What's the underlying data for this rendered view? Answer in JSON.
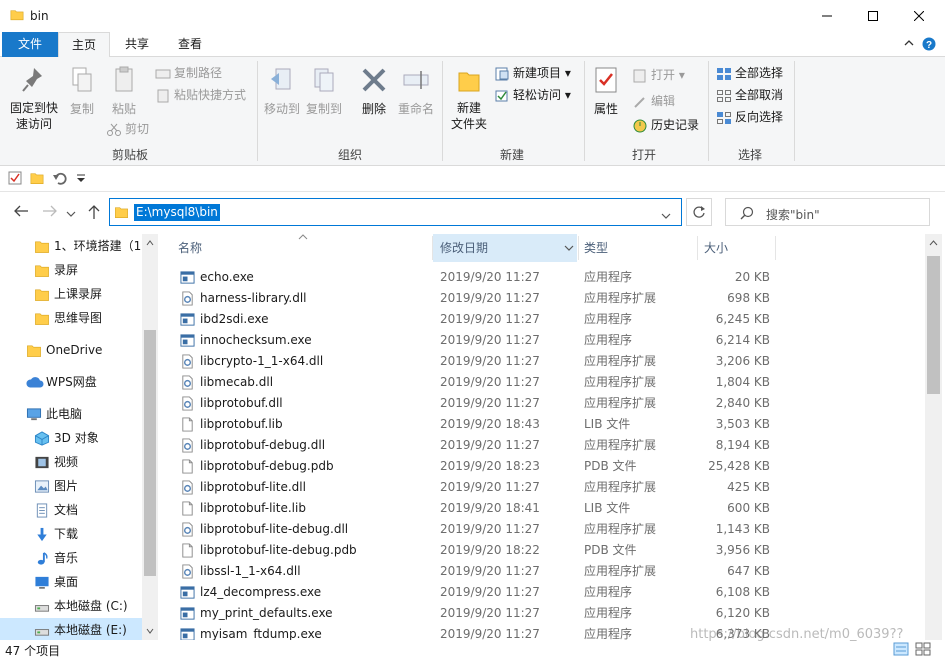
{
  "window": {
    "title": "bin"
  },
  "tabs": {
    "file": "文件",
    "home": "主页",
    "share": "共享",
    "view": "查看"
  },
  "ribbon": {
    "pin": "固定到快\n速访问",
    "copy": "复制",
    "paste": "粘贴",
    "copy_path": "复制路径",
    "paste_shortcut": "粘贴快捷方式",
    "cut": "剪切",
    "clipboard_label": "剪贴板",
    "move_to": "移动到",
    "copy_to": "复制到",
    "delete": "删除",
    "rename": "重命名",
    "organize_label": "组织",
    "new_folder": "新建\n文件夹",
    "new_item": "新建项目",
    "easy_access": "轻松访问",
    "new_label": "新建",
    "properties": "属性",
    "open": "打开",
    "edit": "编辑",
    "history": "历史记录",
    "open_label": "打开",
    "select_all": "全部选择",
    "select_none": "全部取消",
    "invert_selection": "反向选择",
    "select_label": "选择"
  },
  "address": {
    "path": "E:\\mysql8\\bin",
    "search_placeholder": "搜索\"bin\""
  },
  "nav": {
    "items": [
      {
        "label": "1、环境搭建（1",
        "icon": "folder-icon"
      },
      {
        "label": "录屏",
        "icon": "folder-icon"
      },
      {
        "label": "上课录屏",
        "icon": "folder-icon"
      },
      {
        "label": "思维导图",
        "icon": "folder-icon"
      },
      {
        "label": "OneDrive",
        "icon": "onedrive-icon"
      },
      {
        "label": "WPS网盘",
        "icon": "wps-cloud-icon"
      },
      {
        "label": "此电脑",
        "icon": "computer-icon"
      },
      {
        "label": "3D 对象",
        "icon": "3d-objects-icon"
      },
      {
        "label": "视频",
        "icon": "video-icon"
      },
      {
        "label": "图片",
        "icon": "pictures-icon"
      },
      {
        "label": "文档",
        "icon": "documents-icon"
      },
      {
        "label": "下载",
        "icon": "download-icon"
      },
      {
        "label": "音乐",
        "icon": "music-icon"
      },
      {
        "label": "桌面",
        "icon": "desktop-icon"
      },
      {
        "label": "本地磁盘 (C:)",
        "icon": "drive-icon"
      },
      {
        "label": "本地磁盘 (E:)",
        "icon": "drive-icon"
      }
    ]
  },
  "columns": {
    "name": "名称",
    "date": "修改日期",
    "type": "类型",
    "size": "大小"
  },
  "files": [
    {
      "name": "echo.exe",
      "date": "2019/9/20 11:27",
      "type": "应用程序",
      "size": "20 KB",
      "kind": "exe"
    },
    {
      "name": "harness-library.dll",
      "date": "2019/9/20 11:27",
      "type": "应用程序扩展",
      "size": "698 KB",
      "kind": "dll"
    },
    {
      "name": "ibd2sdi.exe",
      "date": "2019/9/20 11:27",
      "type": "应用程序",
      "size": "6,245 KB",
      "kind": "exe"
    },
    {
      "name": "innochecksum.exe",
      "date": "2019/9/20 11:27",
      "type": "应用程序",
      "size": "6,214 KB",
      "kind": "exe"
    },
    {
      "name": "libcrypto-1_1-x64.dll",
      "date": "2019/9/20 11:27",
      "type": "应用程序扩展",
      "size": "3,206 KB",
      "kind": "dll"
    },
    {
      "name": "libmecab.dll",
      "date": "2019/9/20 11:27",
      "type": "应用程序扩展",
      "size": "1,804 KB",
      "kind": "dll"
    },
    {
      "name": "libprotobuf.dll",
      "date": "2019/9/20 11:27",
      "type": "应用程序扩展",
      "size": "2,840 KB",
      "kind": "dll"
    },
    {
      "name": "libprotobuf.lib",
      "date": "2019/9/20 18:43",
      "type": "LIB 文件",
      "size": "3,503 KB",
      "kind": "file"
    },
    {
      "name": "libprotobuf-debug.dll",
      "date": "2019/9/20 11:27",
      "type": "应用程序扩展",
      "size": "8,194 KB",
      "kind": "dll"
    },
    {
      "name": "libprotobuf-debug.pdb",
      "date": "2019/9/20 18:23",
      "type": "PDB 文件",
      "size": "25,428 KB",
      "kind": "file"
    },
    {
      "name": "libprotobuf-lite.dll",
      "date": "2019/9/20 11:27",
      "type": "应用程序扩展",
      "size": "425 KB",
      "kind": "dll"
    },
    {
      "name": "libprotobuf-lite.lib",
      "date": "2019/9/20 18:41",
      "type": "LIB 文件",
      "size": "600 KB",
      "kind": "file"
    },
    {
      "name": "libprotobuf-lite-debug.dll",
      "date": "2019/9/20 11:27",
      "type": "应用程序扩展",
      "size": "1,143 KB",
      "kind": "dll"
    },
    {
      "name": "libprotobuf-lite-debug.pdb",
      "date": "2019/9/20 18:22",
      "type": "PDB 文件",
      "size": "3,956 KB",
      "kind": "file"
    },
    {
      "name": "libssl-1_1-x64.dll",
      "date": "2019/9/20 11:27",
      "type": "应用程序扩展",
      "size": "647 KB",
      "kind": "dll"
    },
    {
      "name": "lz4_decompress.exe",
      "date": "2019/9/20 11:27",
      "type": "应用程序",
      "size": "6,108 KB",
      "kind": "exe"
    },
    {
      "name": "my_print_defaults.exe",
      "date": "2019/9/20 11:27",
      "type": "应用程序",
      "size": "6,120 KB",
      "kind": "exe"
    },
    {
      "name": "myisam_ftdump.exe",
      "date": "2019/9/20 11:27",
      "type": "应用程序",
      "size": "6,373 KB",
      "kind": "exe"
    }
  ],
  "status": {
    "count": "47 个项目"
  },
  "watermark": "https://blog.csdn.net/m0_6039??",
  "colors": {
    "accent": "#1979ca",
    "selection": "#cce8ff",
    "sorted_header": "#d9ebf9",
    "folder": "#ffcd4a"
  }
}
